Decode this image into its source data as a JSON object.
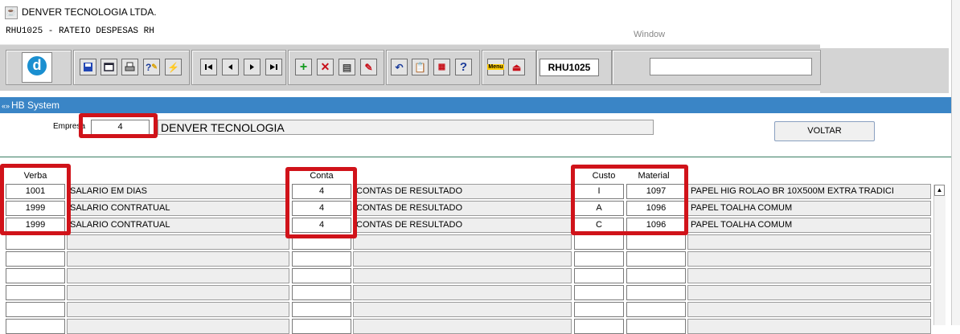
{
  "window": {
    "title": "DENVER TECNOLOGIA LTDA.",
    "subtitle": "RHU1025 - RATEIO DESPESAS RH",
    "menu_window": "Window"
  },
  "toolbar": {
    "form_code": "RHU1025",
    "search_value": ""
  },
  "panel": {
    "title": "HB System"
  },
  "empresa": {
    "label": "Empresa",
    "code": "4",
    "name": "DENVER TECNOLOGIA"
  },
  "buttons": {
    "voltar": "VOLTAR"
  },
  "headers": {
    "verba": "Verba",
    "conta": "Conta",
    "custo": "Custo",
    "material": "Material"
  },
  "rows": [
    {
      "verba": "1001",
      "verba_desc": "SALARIO EM DIAS",
      "conta": "4",
      "conta_desc": "CONTAS DE RESULTADO",
      "custo": "I",
      "material": "1097",
      "material_desc": "PAPEL HIG ROLAO BR 10X500M EXTRA TRADICI"
    },
    {
      "verba": "1999",
      "verba_desc": "SALARIO CONTRATUAL",
      "conta": "4",
      "conta_desc": "CONTAS DE RESULTADO",
      "custo": "A",
      "material": "1096",
      "material_desc": "PAPEL TOALHA COMUM"
    },
    {
      "verba": "1999",
      "verba_desc": "SALARIO CONTRATUAL",
      "conta": "4",
      "conta_desc": "CONTAS DE RESULTADO",
      "custo": "C",
      "material": "1096",
      "material_desc": "PAPEL TOALHA COMUM"
    },
    {
      "verba": "",
      "verba_desc": "",
      "conta": "",
      "conta_desc": "",
      "custo": "",
      "material": "",
      "material_desc": ""
    },
    {
      "verba": "",
      "verba_desc": "",
      "conta": "",
      "conta_desc": "",
      "custo": "",
      "material": "",
      "material_desc": ""
    },
    {
      "verba": "",
      "verba_desc": "",
      "conta": "",
      "conta_desc": "",
      "custo": "",
      "material": "",
      "material_desc": ""
    },
    {
      "verba": "",
      "verba_desc": "",
      "conta": "",
      "conta_desc": "",
      "custo": "",
      "material": "",
      "material_desc": ""
    },
    {
      "verba": "",
      "verba_desc": "",
      "conta": "",
      "conta_desc": "",
      "custo": "",
      "material": "",
      "material_desc": ""
    },
    {
      "verba": "",
      "verba_desc": "",
      "conta": "",
      "conta_desc": "",
      "custo": "",
      "material": "",
      "material_desc": ""
    }
  ]
}
